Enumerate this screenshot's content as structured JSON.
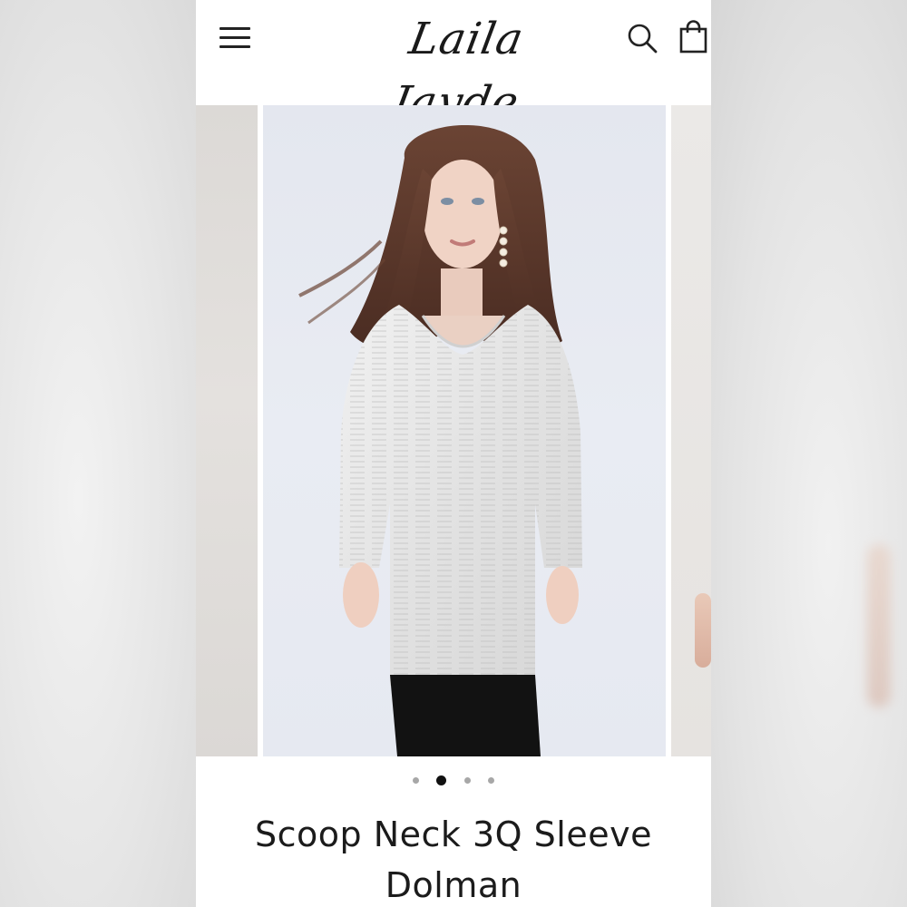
{
  "header": {
    "brand": "Laila Jayde",
    "menu_icon": "hamburger-menu-icon",
    "search_icon": "search-icon",
    "cart_icon": "shopping-bag-icon"
  },
  "carousel": {
    "slide_count": 4,
    "active_index": 1,
    "zoom_icon": "zoom-icon"
  },
  "product": {
    "title": "Scoop Neck 3Q Sleeve Dolman"
  },
  "colors": {
    "text": "#1b1b1b",
    "photo_background": "#e6e9f1",
    "active_dot": "#111111",
    "inactive_dot": "#a7a7a7"
  }
}
